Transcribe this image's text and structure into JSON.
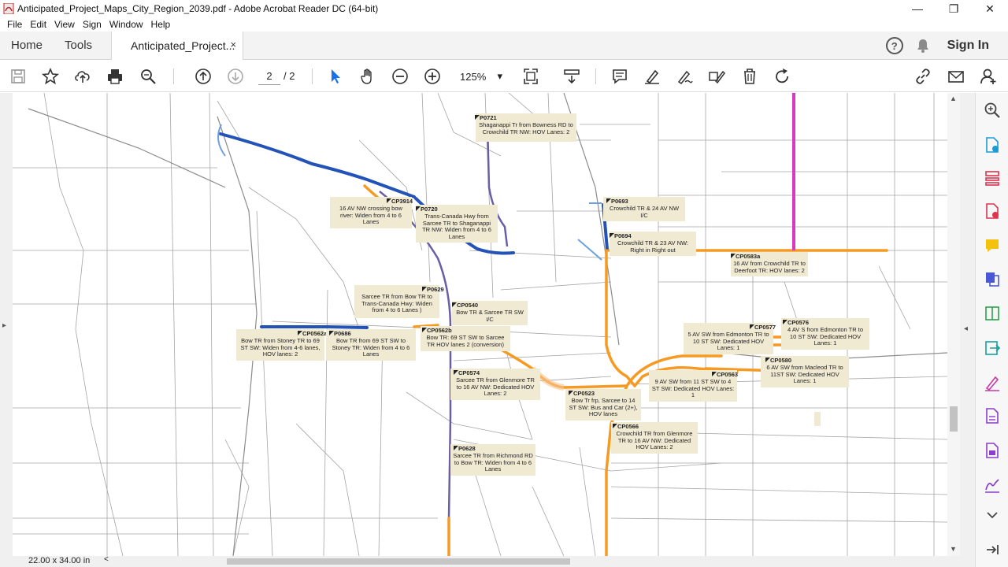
{
  "window": {
    "title": "Anticipated_Project_Maps_City_Region_2039.pdf - Adobe Acrobat Reader DC (64-bit)",
    "minimize": "—",
    "restore": "❐",
    "close": "✕"
  },
  "menu": [
    "File",
    "Edit",
    "View",
    "Sign",
    "Window",
    "Help"
  ],
  "tabs": {
    "home": "Home",
    "tools": "Tools",
    "document": "Anticipated_Project...",
    "close": "×",
    "signin": "Sign In",
    "help": "?"
  },
  "toolbar": {
    "page_current": "2",
    "page_total": "/ 2",
    "zoom": "125%",
    "zoom_arrow": "▾",
    "icons": [
      "save-icon",
      "bookmark-star-icon",
      "upload-icon",
      "print-icon",
      "find-icon",
      "page-up-icon",
      "page-down-icon",
      "select-arrow-icon",
      "hand-icon",
      "zoom-out-icon",
      "zoom-in-icon",
      "fit-page-icon",
      "scroll-mode-icon",
      "comment-icon",
      "highlight-icon",
      "sign-icon",
      "fill-sign-icon",
      "delete-icon",
      "rotate-icon",
      "link-icon",
      "email-icon",
      "add-user-icon"
    ]
  },
  "status": {
    "page_size": "22.00 x 34.00 in",
    "scroll_left": "<"
  },
  "side_arrows": {
    "left": "▸",
    "right": "◂",
    "up": "▲",
    "down": "▼"
  },
  "colors": {
    "blue_route": "#2453b8",
    "orange_route": "#f59a23",
    "magenta_route": "#d63bbf",
    "label_bg": "#f1ead3",
    "road": "#9a9a9a"
  },
  "labels": [
    {
      "id": "P0721",
      "text": "Shaganappi Tr from Bowness RD to Crowchild TR NW: HOV Lanes: 2"
    },
    {
      "id": "CP3914",
      "text": "16 AV NW  crossing bow river: Widen from 4 to 6 Lanes"
    },
    {
      "id": "P0720",
      "text": "Trans-Canada Hwy from Sarcee TR to Shaganappi TR NW: Widen from 4 to 6 Lanes"
    },
    {
      "id": "P0693",
      "text": "Crowchild TR & 24 AV NW I/C"
    },
    {
      "id": "P0694",
      "text": "Crowchild TR & 23 AV NW: Right in Right out"
    },
    {
      "id": "CP0583a",
      "text": "16 AV from Crowchild TR to Deerfoot TR: HOV lanes: 2"
    },
    {
      "id": "P0629",
      "text": "Sarcee TR from Bow TR to Trans-Canada Hwy: Widen from 4 to 6 Lanes )"
    },
    {
      "id": "CP0540",
      "text": "Bow TR & Sarcee TR SW I/C"
    },
    {
      "id": "CP0562a",
      "text": "Bow TR from Stoney TR to 69 ST SW: Widen from 4-6 lanes, HOV lanes: 2"
    },
    {
      "id": "P0686",
      "text": "Bow TR from 69 ST SW to Stoney TR: Widen from 4 to 6 Lanes"
    },
    {
      "id": "CP0562b",
      "text": "Bow TR:  69 ST SW to Sarcee TR HOV lanes 2 (conversion)"
    },
    {
      "id": "CP0577",
      "text": "5 AV SW from Edmonton TR to 10 ST SW: Dedicated HOV Lanes: 1"
    },
    {
      "id": "CP0576",
      "text": "4 AV S from Edmonton TR to 10 ST SW: Dedicated HOV Lanes: 1"
    },
    {
      "id": "CP0580",
      "text": "6 AV SW from Macleod TR to 11ST SW: Dedicated HOV Lanes: 1"
    },
    {
      "id": "CP0563",
      "text": "9 AV SW from 11 ST SW to 4 ST SW: Dedicated HOV Lanes: 1"
    },
    {
      "id": "CP0574",
      "text": "Sarcee TR from Glenmore TR to 16 AV NW: Dedicated HOV Lanes: 2"
    },
    {
      "id": "CP0523",
      "text": "Bow Tr frp, Sarcee to 14 ST SW: Bus and Car (2+), HOV lanes"
    },
    {
      "id": "CP0566",
      "text": "Crowchild TR from Glenmore TR to 16 AV NW: Dedicated HOV Lanes: 2"
    },
    {
      "id": "P0628",
      "text": "Sarcee TR from Richmond RD to Bow TR: Widen from 4 to 6 Lanes"
    }
  ]
}
